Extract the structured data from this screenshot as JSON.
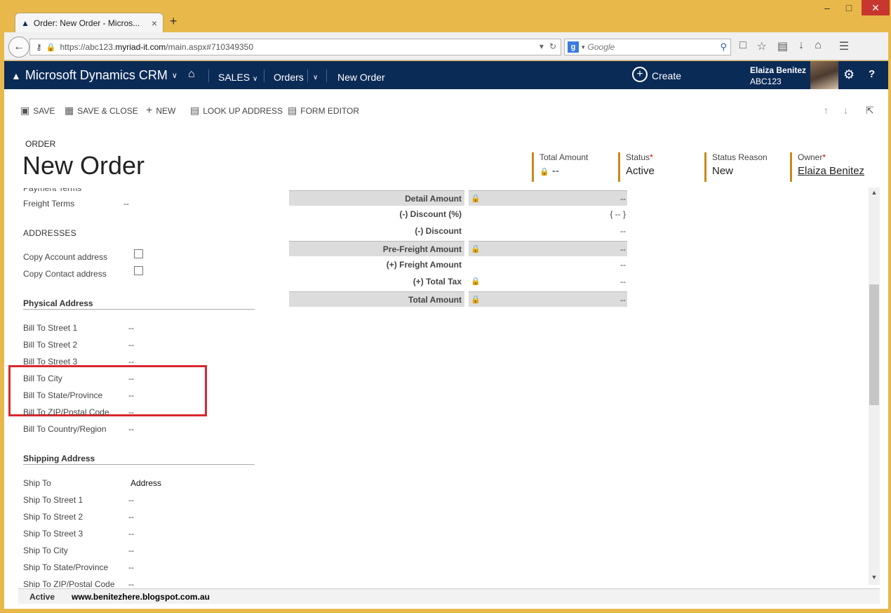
{
  "browser": {
    "tab_title": "Order: New Order - Micros...",
    "url_prefix": "https://abc123.",
    "url_domain": "myriad-it.com",
    "url_path": "/main.aspx#710349350",
    "search_placeholder": "Google",
    "search_engine_letter": "g"
  },
  "crm": {
    "app_name": "Microsoft Dynamics CRM",
    "nav_sales": "SALES",
    "nav_orders": "Orders",
    "nav_new_order": "New Order",
    "create_label": "Create",
    "user_name": "Elaiza Benitez",
    "user_org": "ABC123"
  },
  "commands": {
    "save": "SAVE",
    "save_close": "SAVE & CLOSE",
    "new": "NEW",
    "lookup_address": "LOOK UP ADDRESS",
    "form_editor": "FORM EDITOR"
  },
  "header": {
    "entity": "ORDER",
    "title": "New Order",
    "total_amount_label": "Total Amount",
    "total_amount_value": "--",
    "status_label": "Status",
    "status_value": "Active",
    "status_reason_label": "Status Reason",
    "status_reason_value": "New",
    "owner_label": "Owner",
    "owner_value": "Elaiza Benitez",
    "required_mark": "*"
  },
  "form": {
    "payment_terms_label": "Payment Terms",
    "freight_terms_label": "Freight Terms",
    "freight_terms_value": "--",
    "addresses_title": "ADDRESSES",
    "copy_account_label": "Copy Account address",
    "copy_contact_label": "Copy Contact address",
    "physical_address_title": "Physical Address",
    "bill_fields": [
      {
        "label": "Bill To Street 1",
        "value": "--"
      },
      {
        "label": "Bill To Street 2",
        "value": "--"
      },
      {
        "label": "Bill To Street 3",
        "value": "--"
      },
      {
        "label": "Bill To City",
        "value": "--"
      },
      {
        "label": "Bill To State/Province",
        "value": "--"
      },
      {
        "label": "Bill To ZIP/Postal Code",
        "value": "--"
      },
      {
        "label": "Bill To Country/Region",
        "value": "--"
      }
    ],
    "shipping_address_title": "Shipping Address",
    "ship_to_label": "Ship To",
    "ship_to_value": "Address",
    "ship_fields": [
      {
        "label": "Ship To Street 1",
        "value": "--"
      },
      {
        "label": "Ship To Street 2",
        "value": "--"
      },
      {
        "label": "Ship To Street 3",
        "value": "--"
      },
      {
        "label": "Ship To City",
        "value": "--"
      },
      {
        "label": "Ship To State/Province",
        "value": "--"
      },
      {
        "label": "Ship To ZIP/Postal Code",
        "value": "--"
      }
    ]
  },
  "summary": [
    {
      "label": "Detail Amount",
      "value": "--",
      "locked": true,
      "shaded": true
    },
    {
      "label": "(-) Discount (%)",
      "value": "{ -- }",
      "locked": false,
      "shaded": false
    },
    {
      "label": "(-) Discount",
      "value": "--",
      "locked": false,
      "shaded": false
    },
    {
      "label": "Pre-Freight Amount",
      "value": "--",
      "locked": true,
      "shaded": true
    },
    {
      "label": "(+) Freight Amount",
      "value": "--",
      "locked": false,
      "shaded": false
    },
    {
      "label": "(+) Total Tax",
      "value": "--",
      "locked": true,
      "shaded": false
    },
    {
      "label": "Total Amount",
      "value": "--",
      "locked": true,
      "shaded": true
    }
  ],
  "statusbar": {
    "status": "Active",
    "watermark": "www.benitezhere.blogspot.com.au"
  },
  "colors": {
    "crm_nav": "#0b2b57",
    "header_accent": "#c9891b",
    "highlight_box": "#d9272e",
    "window_frame": "#e8b94a"
  }
}
